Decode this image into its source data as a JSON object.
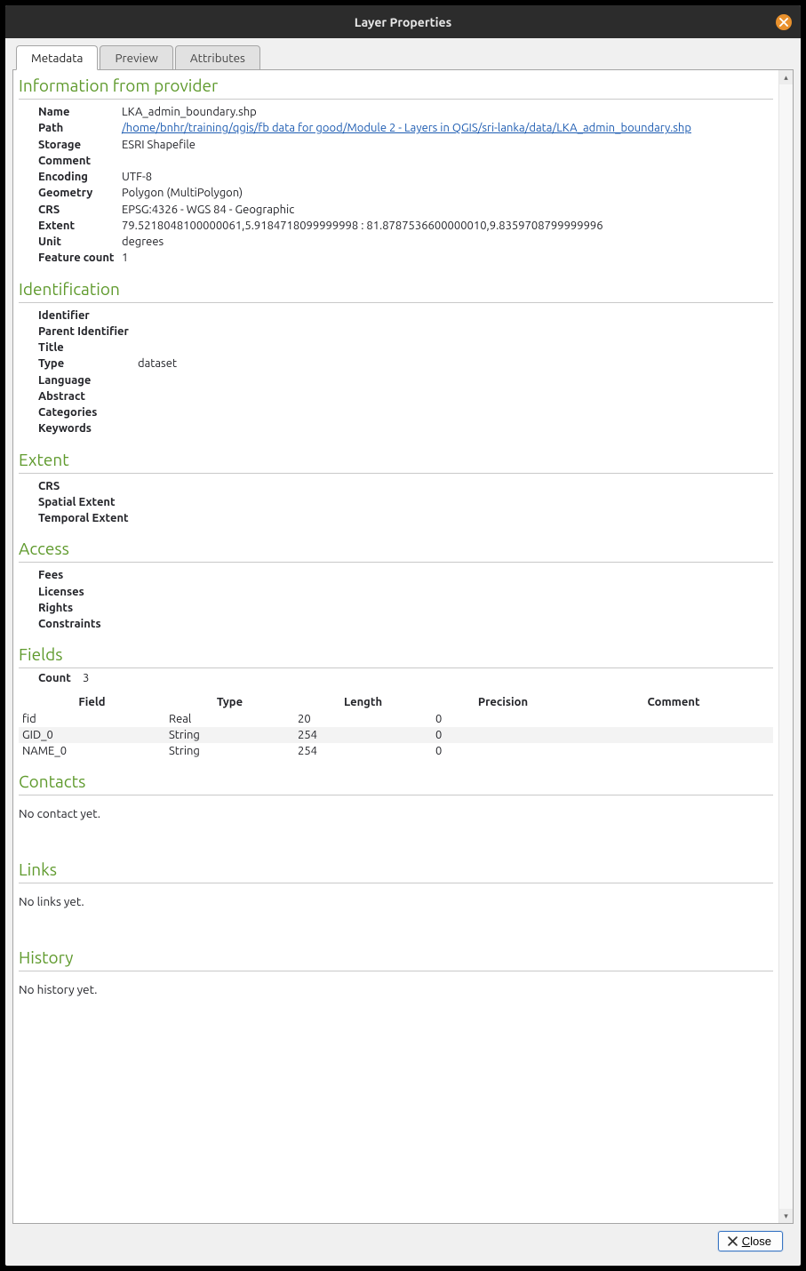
{
  "window": {
    "title": "Layer Properties"
  },
  "tabs": {
    "metadata": "Metadata",
    "preview": "Preview",
    "attributes": "Attributes"
  },
  "sections": {
    "provider": "Information from provider",
    "identification": "Identification",
    "extent": "Extent",
    "access": "Access",
    "fields": "Fields",
    "contacts": "Contacts",
    "links": "Links",
    "history": "History"
  },
  "provider": {
    "labels": {
      "name": "Name",
      "path": "Path",
      "storage": "Storage",
      "comment": "Comment",
      "encoding": "Encoding",
      "geometry": "Geometry",
      "crs": "CRS",
      "extent": "Extent",
      "unit": "Unit",
      "feature_count": "Feature count"
    },
    "values": {
      "name": "LKA_admin_boundary.shp",
      "path": "/home/bnhr/training/qgis/fb data for good/Module 2 - Layers in QGIS/sri-lanka/data/LKA_admin_boundary.shp",
      "storage": "ESRI Shapefile",
      "comment": "",
      "encoding": "UTF-8",
      "geometry": "Polygon (MultiPolygon)",
      "crs": "EPSG:4326 - WGS 84 - Geographic",
      "extent": "79.5218048100000061,5.9184718099999998 : 81.8787536600000010,9.8359708799999996",
      "unit": "degrees",
      "feature_count": "1"
    }
  },
  "identification": {
    "labels": {
      "identifier": "Identifier",
      "parent_identifier": "Parent Identifier",
      "title": "Title",
      "type": "Type",
      "language": "Language",
      "abstract": "Abstract",
      "categories": "Categories",
      "keywords": "Keywords"
    },
    "values": {
      "identifier": "",
      "parent_identifier": "",
      "title": "",
      "type": "dataset",
      "language": "",
      "abstract": "",
      "categories": "",
      "keywords": ""
    }
  },
  "extent": {
    "labels": {
      "crs": "CRS",
      "spatial_extent": "Spatial Extent",
      "temporal_extent": "Temporal Extent"
    },
    "values": {
      "crs": "",
      "spatial_extent": "",
      "temporal_extent": ""
    }
  },
  "access": {
    "labels": {
      "fees": "Fees",
      "licenses": "Licenses",
      "rights": "Rights",
      "constraints": "Constraints"
    },
    "values": {
      "fees": "",
      "licenses": "",
      "rights": "",
      "constraints": ""
    }
  },
  "fields": {
    "count_label": "Count",
    "count_value": "3",
    "headers": {
      "field": "Field",
      "type": "Type",
      "length": "Length",
      "precision": "Precision",
      "comment": "Comment"
    },
    "rows": [
      {
        "field": "fid",
        "type": "Real",
        "length": "20",
        "precision": "0",
        "comment": ""
      },
      {
        "field": "GID_0",
        "type": "String",
        "length": "254",
        "precision": "0",
        "comment": ""
      },
      {
        "field": "NAME_0",
        "type": "String",
        "length": "254",
        "precision": "0",
        "comment": ""
      }
    ]
  },
  "contacts": {
    "message": "No contact yet."
  },
  "links": {
    "message": "No links yet."
  },
  "history": {
    "message": "No history yet."
  },
  "footer": {
    "close_prefix": "C",
    "close_rest": "lose"
  }
}
